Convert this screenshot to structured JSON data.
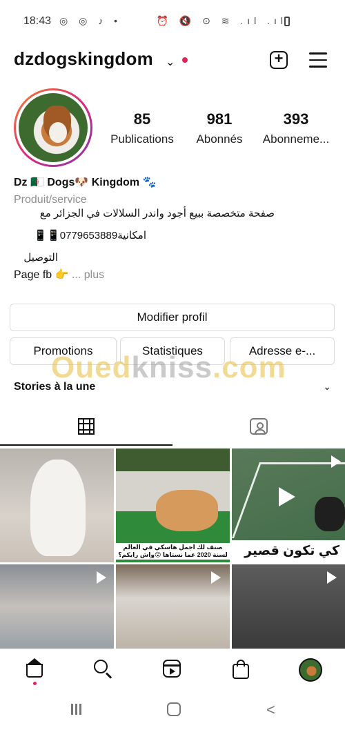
{
  "status_bar": {
    "time": "18:43",
    "left_icons": "◎ ◎ ♪ •",
    "right_icons": "⏰ 🔇 ⊙ ≋ .ıl .ıl"
  },
  "header": {
    "username": "dzdogskingdom",
    "chevron": "⌄",
    "plus": "+"
  },
  "stats": {
    "posts_count": "85",
    "posts_label": "Publications",
    "followers_count": "981",
    "followers_label": "Abonnés",
    "following_count": "393",
    "following_label": "Abonneme..."
  },
  "bio": {
    "name": "Dz 🇩🇿 Dogs🐶 Kingdom 🐾",
    "category": "Produit/service",
    "line1": "صفحة متخصصة ببيع أجود واندر السلالات في الجزائر مع",
    "line2": "امكانية0779653889📱📱",
    "line3": "التوصيل",
    "page_fb": "Page fb 👉",
    "more": "... plus"
  },
  "buttons": {
    "edit_profile": "Modifier profil",
    "promotions": "Promotions",
    "statistics": "Statistiques",
    "email": "Adresse e-..."
  },
  "watermark": {
    "part1": "Oued",
    "part2": "kniss",
    "part3": ".com"
  },
  "stories": {
    "title": "Stories à la une",
    "chevron": "⌄"
  },
  "posts": {
    "caption2": "صنف لك اجمل هاسكي في العالم لسنة 2020 عما نستاها 😮واش رايكم؟",
    "caption3": "كي تكون قصير 🤣🤣"
  },
  "colors": {
    "accent": "#e0245e",
    "text": "#111111",
    "muted": "#8e8e8e",
    "border": "#dbdbdb"
  }
}
